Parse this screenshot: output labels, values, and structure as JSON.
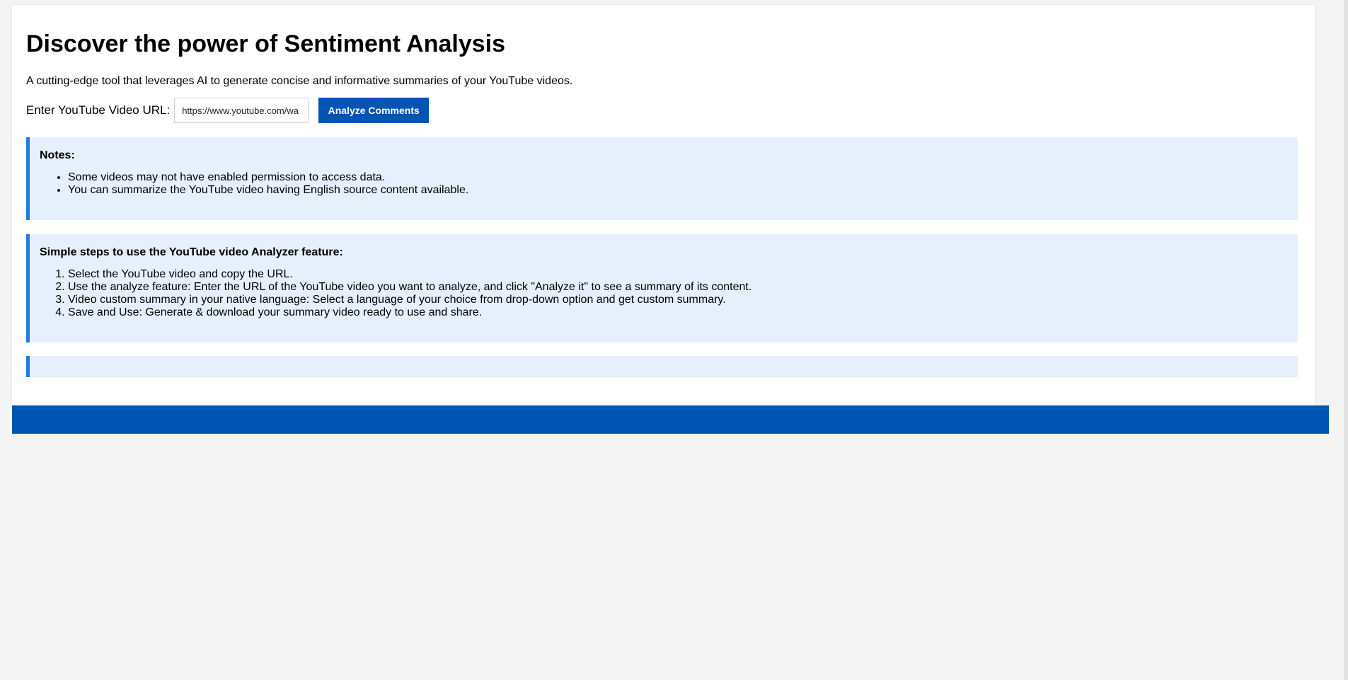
{
  "header": {
    "title": "Discover the power of Sentiment Analysis",
    "subtitle": "A cutting-edge tool that leverages AI to generate concise and informative summaries of your YouTube videos."
  },
  "form": {
    "url_label": "Enter YouTube Video URL:",
    "url_value": "https://www.youtube.com/wa",
    "analyze_button": "Analyze Comments"
  },
  "notes": {
    "heading": "Notes:",
    "items": [
      "Some videos may not have enabled permission to access data.",
      "You can summarize the YouTube video having English source content available."
    ]
  },
  "steps": {
    "heading": "Simple steps to use the YouTube video Analyzer feature:",
    "items": [
      "Select the YouTube video and copy the URL.",
      "Use the analyze feature: Enter the URL of the YouTube video you want to analyze, and click \"Analyze it\" to see a summary of its content.",
      "Video custom summary in your native language: Select a language of your choice from drop-down option and get custom summary.",
      "Save and Use: Generate & download your summary video ready to use and share."
    ]
  },
  "colors": {
    "accent": "#0055b3",
    "info_background": "#e6f0fc",
    "info_border": "#1f7ae6",
    "page_background": "#f4f4f4"
  }
}
